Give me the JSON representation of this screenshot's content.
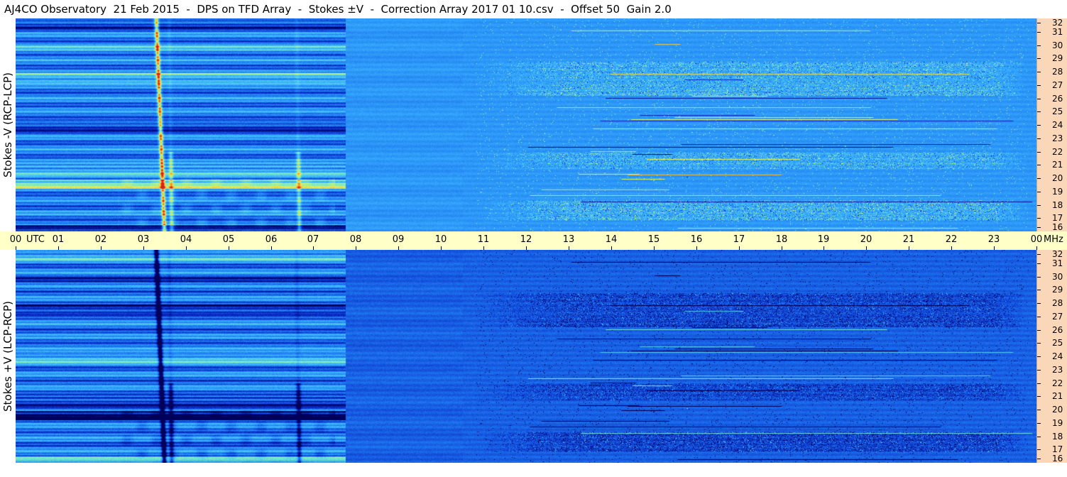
{
  "title": "AJ4CO Observatory  21 Feb 2015  -  DPS on TFD Array  -  Stokes ±V  -  Correction Array 2017 01 10.csv  -  Offset 50  Gain 2.0",
  "chart_data": [
    {
      "type": "heatmap",
      "panel": "Stokes -V (RCP-LCP)",
      "ylabel": "Stokes -V (RCP-LCP)",
      "x_unit": "UTC",
      "y_unit": "MHz",
      "x_range": [
        0,
        24
      ],
      "y_range": [
        16,
        32
      ],
      "x_ticks": [
        "00",
        "01",
        "02",
        "03",
        "04",
        "05",
        "06",
        "07",
        "08",
        "09",
        "10",
        "11",
        "12",
        "13",
        "14",
        "15",
        "16",
        "17",
        "18",
        "19",
        "20",
        "21",
        "22",
        "23",
        "00"
      ],
      "y_ticks": [
        "16",
        "17",
        "18",
        "19",
        "20",
        "21",
        "22",
        "23",
        "24",
        "25",
        "26",
        "27",
        "28",
        "29",
        "30",
        "31",
        "32"
      ],
      "colormap": [
        "#00005a",
        "#0a2ac8",
        "#1e78f0",
        "#3ab4ff",
        "#78ebc8",
        "#e6f050",
        "#ff9628",
        "#dc1e1e"
      ],
      "bursts_utc": [
        3.3,
        3.6,
        6.6
      ],
      "data_gap_utc": [
        7.75,
        24
      ]
    },
    {
      "type": "heatmap",
      "panel": "Stokes +V (LCP-RCP)",
      "ylabel": "Stokes +V (LCP-RCP)",
      "x_unit": "UTC",
      "y_unit": "MHz",
      "x_range": [
        0,
        24
      ],
      "y_range": [
        16,
        32
      ],
      "x_ticks": [
        "00",
        "01",
        "02",
        "03",
        "04",
        "05",
        "06",
        "07",
        "08",
        "09",
        "10",
        "11",
        "12",
        "13",
        "14",
        "15",
        "16",
        "17",
        "18",
        "19",
        "20",
        "21",
        "22",
        "23",
        "00"
      ],
      "y_ticks": [
        "16",
        "17",
        "18",
        "19",
        "20",
        "21",
        "22",
        "23",
        "24",
        "25",
        "26",
        "27",
        "28",
        "29",
        "30",
        "31",
        "32"
      ],
      "colormap": [
        "#00005a",
        "#0a2ac8",
        "#1e78f0",
        "#3ab4ff",
        "#78ebc8",
        "#e6f050",
        "#ff9628",
        "#dc1e1e"
      ],
      "bursts_utc": [
        3.3,
        3.6,
        6.6
      ],
      "data_gap_utc": [
        7.75,
        24
      ]
    }
  ]
}
